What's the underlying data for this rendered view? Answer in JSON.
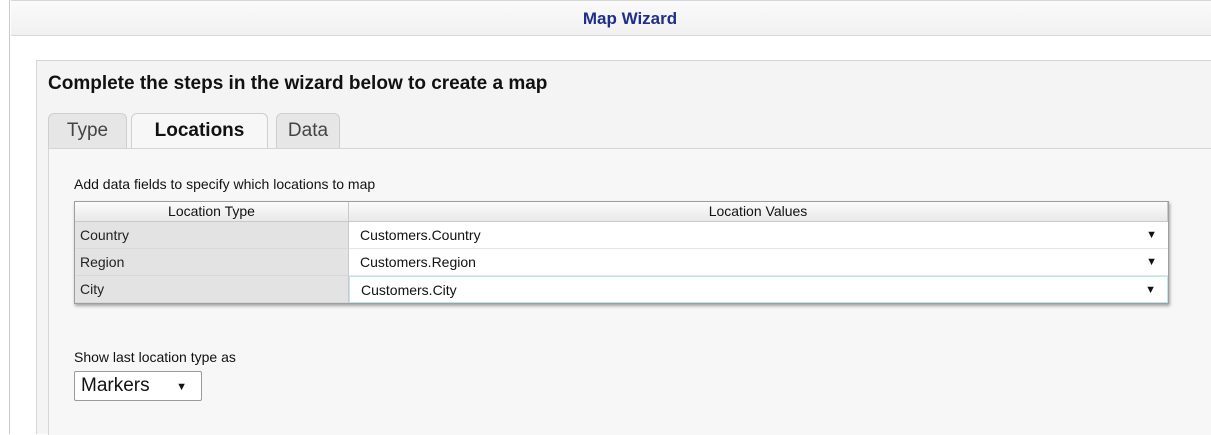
{
  "window": {
    "title": "Map Wizard"
  },
  "heading": "Complete the steps in the wizard below to create a map",
  "tabs": [
    {
      "label": "Type",
      "active": false
    },
    {
      "label": "Locations",
      "active": true
    },
    {
      "label": "Data",
      "active": false
    }
  ],
  "locations": {
    "instruction": "Add data fields to specify which locations to map",
    "columns": [
      "Location Type",
      "Location Values"
    ],
    "rows": [
      {
        "type": "Country",
        "value": "Customers.Country"
      },
      {
        "type": "Region",
        "value": "Customers.Region"
      },
      {
        "type": "City",
        "value": "Customers.City"
      }
    ],
    "dropdown_arrow": "▼"
  },
  "show_last": {
    "label": "Show last location type as",
    "selected": "Markers",
    "arrow": "▼"
  }
}
